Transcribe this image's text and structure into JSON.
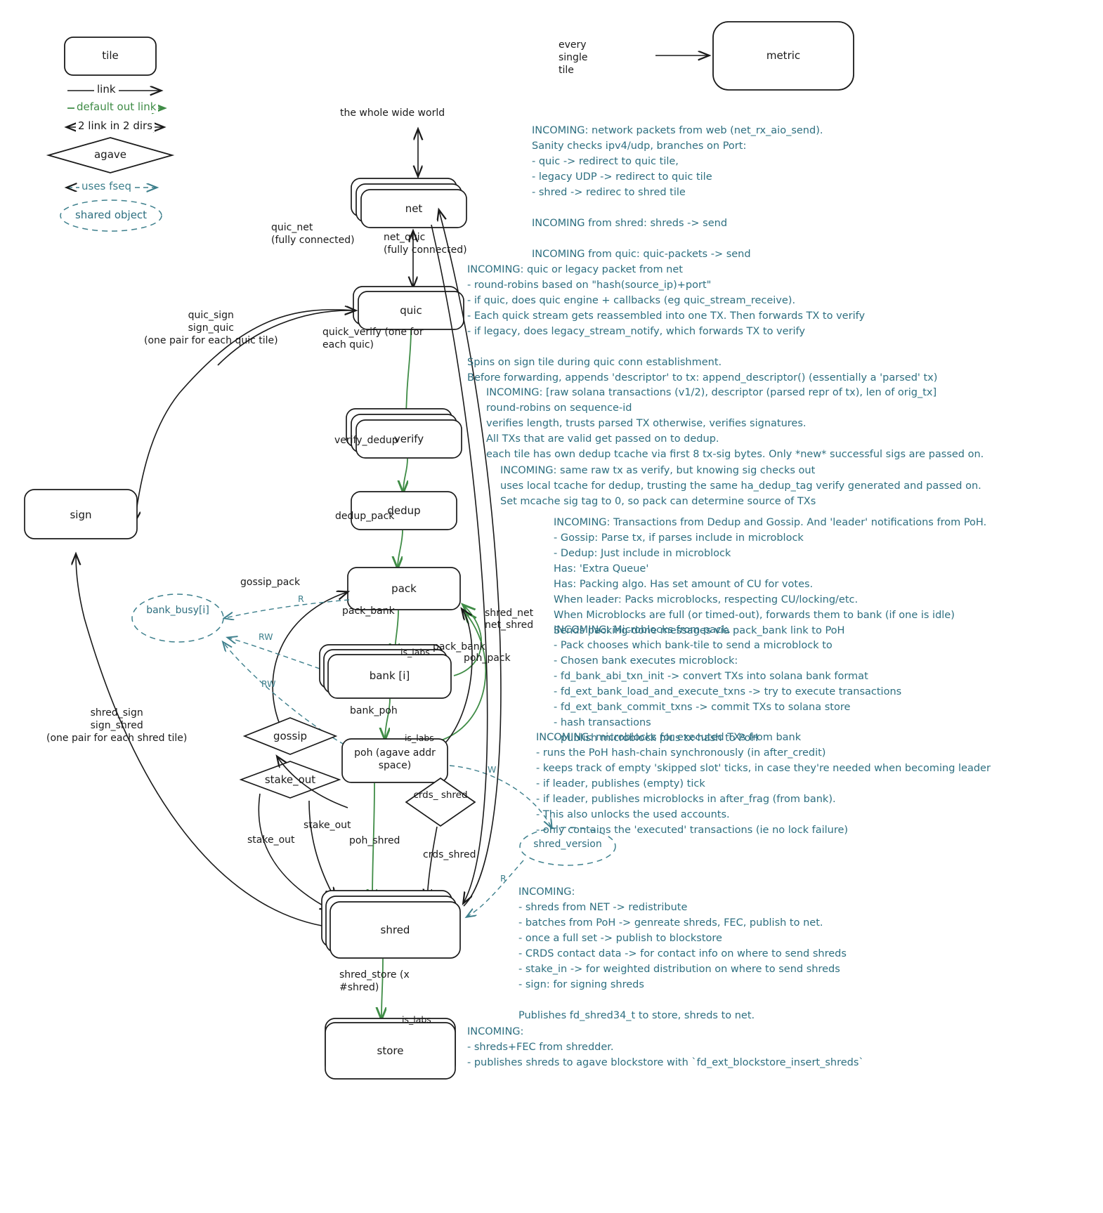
{
  "legend": {
    "tile_label": "tile",
    "link_label": "link",
    "default_out_link_label": "default out link",
    "two_link_label": "2 link in 2 dirs",
    "agave_label": "agave",
    "uses_fseq_label": "uses fseq",
    "shared_object_label": "shared object"
  },
  "metric": {
    "source_label": "every\nsingle\ntile",
    "node_label": "metric"
  },
  "nodes": {
    "world": "the whole wide world",
    "net": "net",
    "quic": "quic",
    "verify": "verify",
    "dedup": "dedup",
    "pack": "pack",
    "bank": "bank [i]",
    "poh": "poh\n(agave addr space)",
    "gossip": "gossip",
    "stake_out": "stake_out",
    "crds_shred": "crds_\nshred",
    "shred": "shred",
    "store": "store",
    "sign": "sign",
    "bank_busy": "bank_busy[i]",
    "shred_version": "shred_version"
  },
  "tags": {
    "is_labs_bank": "is_labs",
    "is_labs_poh": "is_labs",
    "is_labs_store": "is_labs",
    "rw1": "RW",
    "rw2": "RW",
    "r1": "R",
    "r2": "R",
    "w1": "W"
  },
  "edges": {
    "quic_net": "quic_net\n(fully connected)",
    "net_quic": "net_quic\n(fully connected)",
    "quic_sign": "quic_sign\nsign_quic\n(one pair for each quic tile)",
    "quic_verify": "quick_verify (one for\neach quic)",
    "verify_dedup": "verify_dedup",
    "dedup_pack": "dedup_pack",
    "gossip_pack": "gossip_pack",
    "pack_bank": "pack_bank",
    "bank_poh": "bank_poh",
    "pack_bank2": "pack_bank",
    "poh_pack": "poh_pack",
    "shred_net": "shred_net",
    "net_shred": "net_shred",
    "poh_shred": "poh_shred",
    "crds_shred": "crds_shred",
    "stake_out_a": "stake_out",
    "stake_out_b": "stake_out",
    "shred_sign": "shred_sign\nsign_shred\n(one pair for each shred tile)",
    "shred_store": "shred_store (x\n#shred)"
  },
  "notes": {
    "net": "INCOMING: network packets from web (net_rx_aio_send).\nSanity checks ipv4/udp, branches on Port:\n- quic -> redirect to quic tile,\n- legacy UDP -> redirect to quic tile\n- shred -> redirec to shred tile\n\nINCOMING from shred: shreds -> send\n\nINCOMING from quic: quic-packets -> send",
    "quic": "INCOMING: quic or legacy packet from net\n- round-robins based on \"hash(source_ip)+port\"\n- if quic, does quic engine + callbacks (eg quic_stream_receive).\n- Each quick stream gets reassembled into one TX. Then forwards TX to verify\n- if legacy, does legacy_stream_notify, which forwards TX to verify\n\nSpins on sign tile during quic conn establishment.\nBefore forwarding, appends 'descriptor' to tx: append_descriptor() (essentially a 'parsed' tx)",
    "verify": "INCOMING: [raw solana transactions (v1/2), descriptor (parsed repr of tx), len of orig_tx]\nround-robins on sequence-id\nverifies length, trusts parsed TX otherwise, verifies signatures.\nAll TXs that are valid get passed on to dedup.\neach tile has own dedup tcache via first 8 tx-sig bytes. Only *new* successful sigs are passed on.",
    "dedup": "INCOMING: same raw tx as verify, but knowing sig checks out\nuses local tcache for dedup, trusting the same ha_dedup_tag verify generated and passed on.\nSet mcache sig tag to 0, so pack can determine source of TXs",
    "pack": "INCOMING: Transactions from Dedup and Gossip. And 'leader' notifications from PoH.\n- Gossip: Parse tx, if parses include in microblock\n- Dedup: Just include in microblock\nHas: 'Extra Queue'\nHas: Packing algo. Has set amount of CU for votes.\nWhen leader: Packs microblocks, respecting CU/locking/etc.\nWhen Microblocks are full (or timed-out), forwards them to bank (if one is idle)\nSends packing-done messages via pack_bank link to PoH",
    "bank": "INCOMING: Microblocks from pack.\n- Pack chooses which bank-tile to send a microblock to\n- Chosen bank executes microblock:\n- fd_bank_abi_txn_init -> convert TXs into solana bank format\n- fd_ext_bank_load_and_execute_txns -> try to execute transactions\n- fd_ext_bank_commit_txns -> commit TXs to solana store\n- hash transactions\n- publish microblock plus tx-hash to PoH",
    "poh": "INCOMING: microblocks for executed TXs from bank\n- runs the PoH hash-chain synchronously (in after_credit)\n- keeps track of empty 'skipped slot' ticks, in case they're needed when becoming leader\n- if leader, publishes (empty) tick\n- if leader, publishes microblocks in after_frag (from bank).\n- This also unlocks the used accounts.\n- only contains the 'executed' transactions (ie no lock failure)",
    "shred": "INCOMING:\n- shreds from NET -> redistribute\n- batches from PoH -> genreate shreds, FEC, publish to net.\n- once a full set -> publish to blockstore\n- CRDS contact data -> for contact info on where to send shreds\n- stake_in -> for weighted distribution on where to send shreds\n- sign: for signing shreds\n\nPublishes fd_shred34_t to store, shreds to net.",
    "store": "INCOMING:\n- shreds+FEC from shredder.\n- publishes shreds to agave blockstore with `fd_ext_blockstore_insert_shreds`"
  },
  "colors": {
    "ink": "#1a1a1a",
    "green": "#3f8c46",
    "teal": "#2e6f80",
    "teal_dash": "#3d7f8c"
  }
}
